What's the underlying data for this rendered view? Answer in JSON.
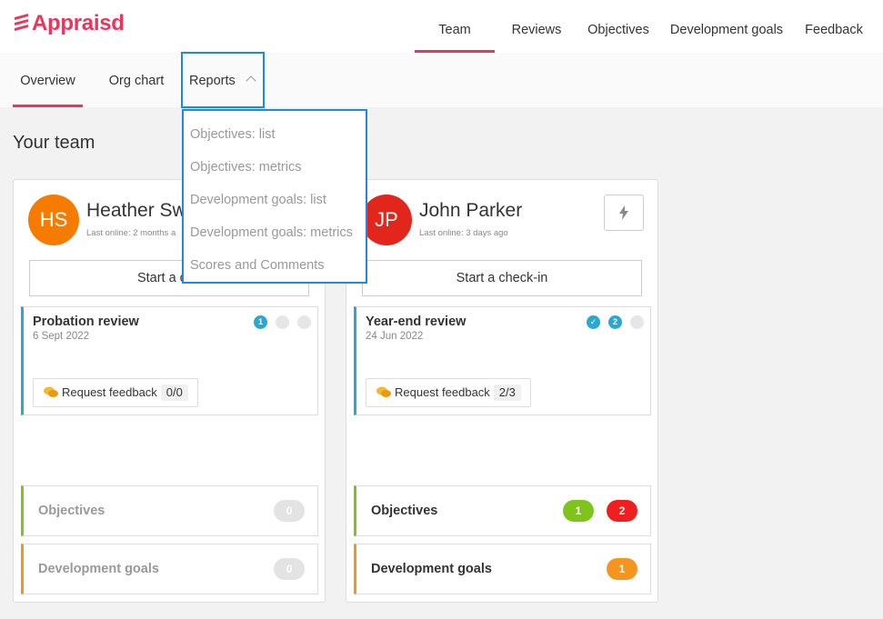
{
  "app": {
    "logo_text": "Appraisd",
    "brand_color": "#e8365d"
  },
  "main_nav": {
    "items": [
      {
        "label": "Team",
        "active": true
      },
      {
        "label": "Reviews",
        "active": false
      },
      {
        "label": "Objectives",
        "active": false
      },
      {
        "label": "Development goals",
        "active": false
      },
      {
        "label": "Feedback",
        "active": false
      }
    ]
  },
  "sub_nav": {
    "overview": "Overview",
    "org_chart": "Org chart",
    "reports": "Reports"
  },
  "reports_menu": {
    "options": [
      "Objectives: list",
      "Objectives: metrics",
      "Development goals: list",
      "Development goals: metrics",
      "Scores and Comments"
    ]
  },
  "section_title": "Your team",
  "members": [
    {
      "initials": "HS",
      "name": "Heather Sw",
      "last_online": "Last online: 2 months a",
      "avatar_color": "#f57c00",
      "checkin_label": "Start a che",
      "review": {
        "title": "Probation review",
        "date": "6 Sept 2022",
        "steps": [
          "1",
          "",
          ""
        ],
        "request_feedback_label": "Request feedback",
        "request_feedback_count": "0/0"
      },
      "objectives": {
        "label": "Objectives",
        "counts": [
          "0"
        ]
      },
      "development_goals": {
        "label": "Development goals",
        "counts": [
          "0"
        ]
      }
    },
    {
      "initials": "JP",
      "name": "John Parker",
      "last_online": "Last online: 3 days ago",
      "avatar_color": "#e3261b",
      "checkin_label": "Start a check-in",
      "review": {
        "title": "Year-end review",
        "date": "24 Jun 2022",
        "steps": [
          "✓",
          "2",
          ""
        ],
        "request_feedback_label": "Request feedback",
        "request_feedback_count": "2/3"
      },
      "objectives": {
        "label": "Objectives",
        "counts": [
          "1",
          "2"
        ]
      },
      "development_goals": {
        "label": "Development goals",
        "counts": [
          "1"
        ]
      }
    }
  ]
}
